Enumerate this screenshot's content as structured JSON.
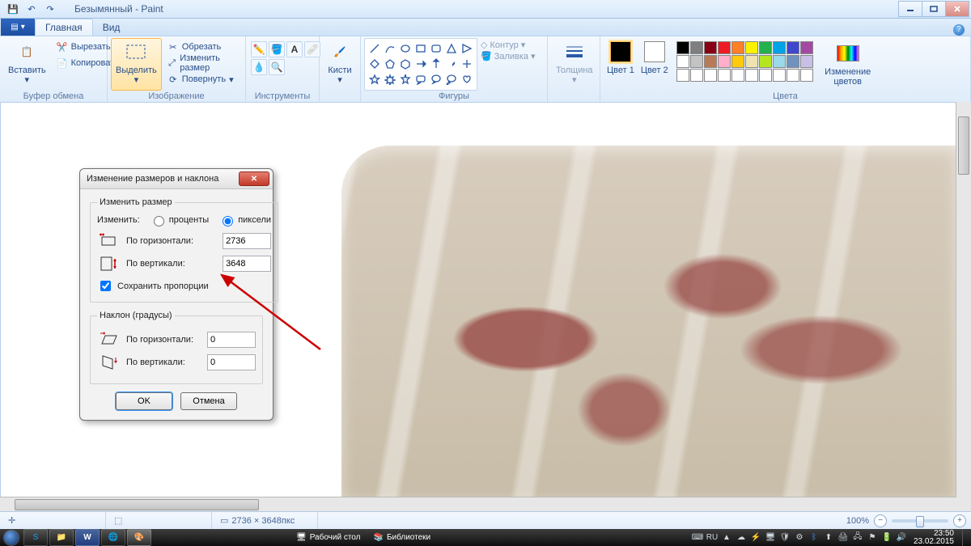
{
  "window": {
    "title": "Безымянный - Paint"
  },
  "tabs": {
    "home": "Главная",
    "view": "Вид"
  },
  "ribbon": {
    "clipboard": {
      "paste": "Вставить",
      "cut": "Вырезать",
      "copy": "Копировать",
      "group": "Буфер обмена"
    },
    "image": {
      "select": "Выделить",
      "crop": "Обрезать",
      "resize": "Изменить размер",
      "rotate": "Повернуть",
      "group": "Изображение"
    },
    "tools": {
      "group": "Инструменты"
    },
    "brushes": {
      "label": "Кисти"
    },
    "shapes": {
      "outline": "Контур",
      "fill": "Заливка",
      "group": "Фигуры"
    },
    "thickness": {
      "label": "Толщина"
    },
    "colors": {
      "color1": "Цвет 1",
      "color2": "Цвет 2",
      "edit": "Изменение цветов",
      "group": "Цвета"
    }
  },
  "palette_row1": [
    "#000000",
    "#7f7f7f",
    "#880015",
    "#ed1c24",
    "#ff7f27",
    "#fff200",
    "#22b14c",
    "#00a2e8",
    "#3f48cc",
    "#a349a4"
  ],
  "palette_row2": [
    "#ffffff",
    "#c3c3c3",
    "#b97a57",
    "#ffaec9",
    "#ffc90e",
    "#efe4b0",
    "#b5e61d",
    "#99d9ea",
    "#7092be",
    "#c8bfe7"
  ],
  "dialog": {
    "title": "Изменение размеров и наклона",
    "resize_legend": "Изменить размер",
    "by_label": "Изменить:",
    "percent": "проценты",
    "pixels": "пиксели",
    "horiz": "По горизонтали:",
    "vert": "По вертикали:",
    "h_val": "2736",
    "v_val": "3648",
    "keep_aspect": "Сохранить пропорции",
    "skew_legend": "Наклон (градусы)",
    "skew_h": "0",
    "skew_v": "0",
    "ok": "OK",
    "cancel": "Отмена"
  },
  "status": {
    "size": "2736 × 3648пкс",
    "zoom": "100%"
  },
  "taskbar": {
    "desktop": "Рабочий стол",
    "libraries": "Библиотеки",
    "lang": "RU",
    "time": "23:50",
    "date": "23.02.2015"
  }
}
